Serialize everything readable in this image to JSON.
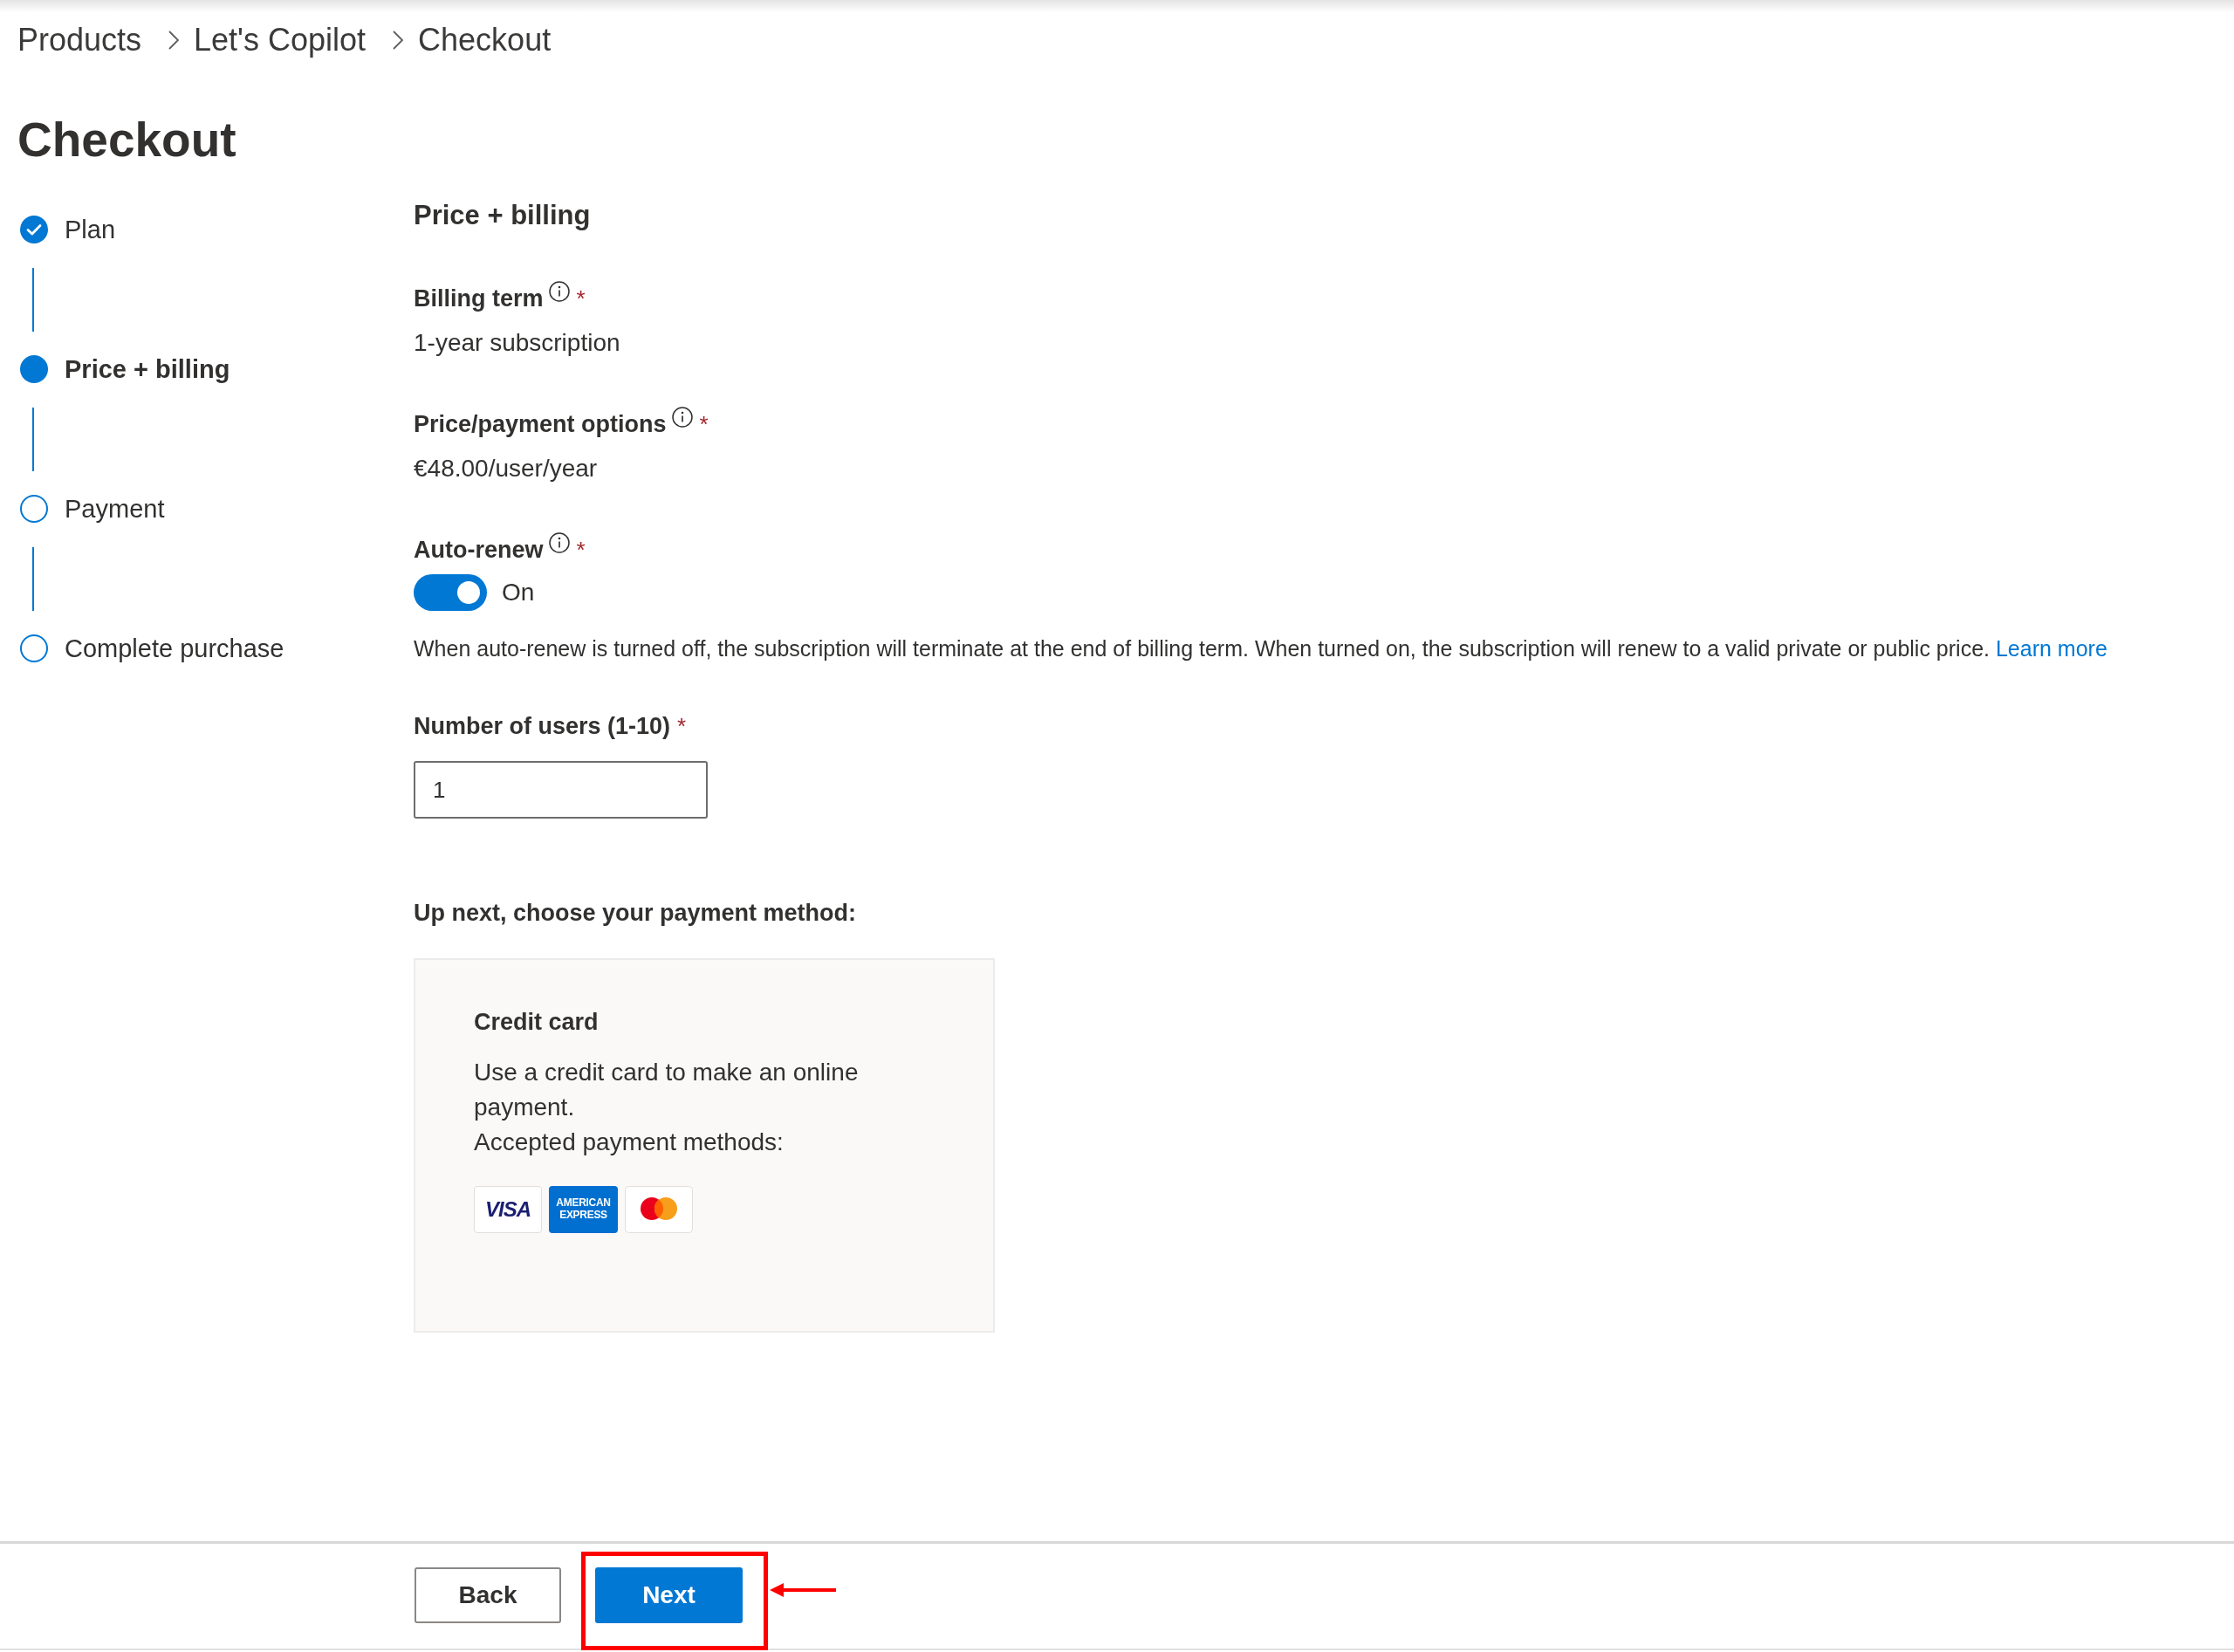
{
  "breadcrumb": [
    {
      "label": "Products"
    },
    {
      "label": "Let's Copilot"
    },
    {
      "label": "Checkout"
    }
  ],
  "title": "Checkout",
  "steps": [
    {
      "label": "Plan",
      "completed": true,
      "selected": false
    },
    {
      "label": "Price + billing",
      "completed": false,
      "selected": true
    },
    {
      "label": "Payment",
      "completed": false,
      "selected": false
    },
    {
      "label": "Complete purchase",
      "completed": false,
      "selected": false
    }
  ],
  "section": {
    "heading": "Price + billing",
    "fields": [
      {
        "kind": "text",
        "label": "Billing term",
        "info": true,
        "required_mark": "*",
        "value": "1-year subscription"
      },
      {
        "kind": "text",
        "label": "Price/payment options",
        "info": true,
        "required_mark": "*",
        "value": "€48.00/user/year"
      },
      {
        "kind": "toggle",
        "label": "Auto-renew",
        "info": true,
        "required_mark": "*",
        "on": true,
        "value": "On",
        "description": "When auto-renew is turned off, the subscription will terminate at the end of billing term. When turned on, the subscription will renew to a valid private or public price.",
        "link": "Learn more"
      },
      {
        "kind": "input",
        "label": "Number of users (1-10)",
        "info": false,
        "required_mark": "*",
        "value": "1"
      }
    ],
    "next_step_prompt": "Up next, choose your payment method:",
    "payment_option": {
      "title": "Credit card",
      "description": "Use a credit card to make an online payment.",
      "accepted_label": "Accepted payment methods:",
      "logos": [
        {
          "kind": "visa",
          "text": "VISA"
        },
        {
          "kind": "amex",
          "text": "AMERICAN EXPRESS"
        },
        {
          "kind": "mastercard"
        }
      ]
    }
  },
  "footer": {
    "buttons": [
      {
        "label": "Back",
        "kind": "secondary",
        "highlighted": false
      },
      {
        "label": "Next",
        "kind": "primary",
        "highlighted": true
      }
    ]
  }
}
